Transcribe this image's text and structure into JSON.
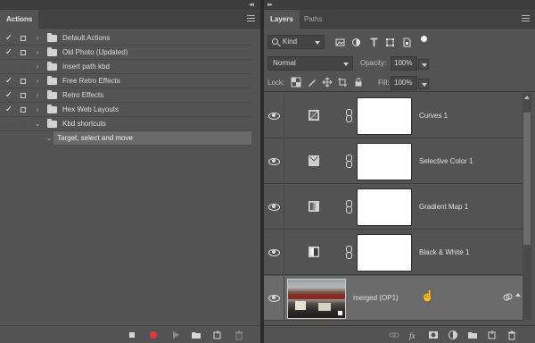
{
  "actions_panel": {
    "tab": "Actions",
    "collapse_glyph": "◂◂",
    "rows": [
      {
        "label": "Default Actions",
        "checked": true,
        "dialog": true,
        "expanded": false,
        "folder": true,
        "selected": false
      },
      {
        "label": "Old Photo (Updated)",
        "checked": true,
        "dialog": true,
        "expanded": false,
        "folder": true,
        "selected": false
      },
      {
        "label": "Insert path kbd",
        "checked": false,
        "dialog": false,
        "expanded": false,
        "folder": true,
        "selected": false
      },
      {
        "label": "Free Retro Effects",
        "checked": true,
        "dialog": true,
        "expanded": false,
        "folder": true,
        "selected": false
      },
      {
        "label": "Retro Effects",
        "checked": true,
        "dialog": true,
        "expanded": false,
        "folder": true,
        "selected": false
      },
      {
        "label": "Hex Web Layouts",
        "checked": true,
        "dialog": true,
        "expanded": false,
        "folder": true,
        "selected": false
      },
      {
        "label": "Kbd shortcuts",
        "checked": false,
        "dialog": false,
        "expanded": true,
        "folder": true,
        "selected": false
      },
      {
        "label": "Target, select and move",
        "checked": false,
        "dialog": false,
        "expanded": true,
        "folder": false,
        "selected": true
      }
    ],
    "check_glyph": "✓",
    "bottom_icons": [
      "stop-icon",
      "record-icon",
      "play-icon",
      "new-set-icon",
      "new-action-icon",
      "delete-icon"
    ],
    "record_color": "#e03a3a"
  },
  "layers_panel": {
    "collapse_glyph": "▸▸",
    "tabs": [
      "Layers",
      "Paths"
    ],
    "filter": {
      "kind_label": "Kind",
      "filter_icons": [
        "image-filter-icon",
        "adjustment-filter-icon",
        "type-filter-icon",
        "shape-filter-icon",
        "smart-object-filter-icon",
        "filter-toggle-icon"
      ]
    },
    "blend_mode": "Normal",
    "opacity_label": "Opacity:",
    "opacity_value": "100%",
    "lock_label": "Lock:",
    "fill_label": "Fill:",
    "fill_value": "100%",
    "layers": [
      {
        "name": "Curves 1",
        "type": "adjustment",
        "icon": "curves-icon"
      },
      {
        "name": "Selective Color 1",
        "type": "adjustment",
        "icon": "selective-color-icon"
      },
      {
        "name": "Gradient Map 1",
        "type": "adjustment",
        "icon": "gradient-map-icon"
      },
      {
        "name": "Black & White 1",
        "type": "adjustment",
        "icon": "black-white-icon"
      },
      {
        "name": "merged (OP1)",
        "type": "smart-object",
        "selected": true
      }
    ],
    "bottom_icons": [
      "link-icon",
      "fx-icon",
      "add-mask-icon",
      "adjustment-layer-icon",
      "group-icon",
      "new-layer-icon",
      "delete-icon"
    ]
  }
}
